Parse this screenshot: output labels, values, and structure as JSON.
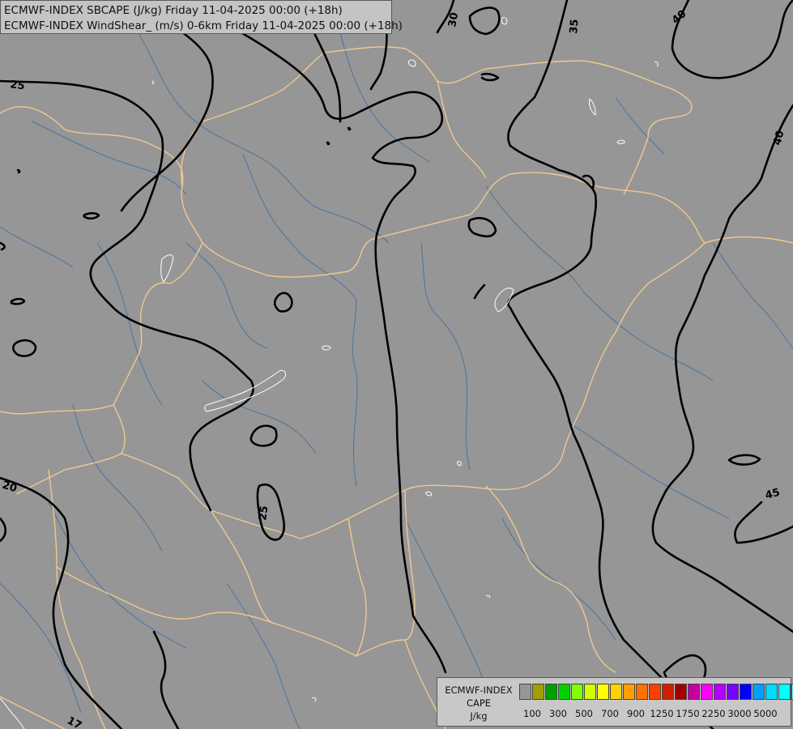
{
  "title": {
    "line1": "ECMWF-INDEX SBCAPE (J/kg) Friday 11-04-2025 00:00 (+18h)",
    "line2": "ECMWF-INDEX WindShear_ (m/s) 0-6km Friday 11-04-2025 00:00 (+18h)"
  },
  "legend": {
    "title": [
      "ECMWF-INDEX",
      "CAPE",
      "J/kg"
    ],
    "colors": [
      "#969696",
      "#a0a000",
      "#00a000",
      "#00d200",
      "#80ff00",
      "#d2ff00",
      "#ffff00",
      "#ffd200",
      "#ffa000",
      "#ff7000",
      "#ff4000",
      "#d21e00",
      "#a00000",
      "#c800a0",
      "#ff00ff",
      "#b400ff",
      "#7800ff",
      "#0000ff",
      "#00a0ff",
      "#00dcff",
      "#00ffff",
      "#80ffff",
      "#ffffff"
    ],
    "tick_labels": [
      "100",
      "300",
      "500",
      "700",
      "900",
      "1250",
      "1750",
      "2250",
      "3000",
      "5000"
    ]
  },
  "contour_labels": [
    {
      "text": "25"
    },
    {
      "text": "30"
    },
    {
      "text": "35"
    },
    {
      "text": "40"
    },
    {
      "text": "40"
    },
    {
      "text": "20"
    },
    {
      "text": "25"
    },
    {
      "text": "45"
    },
    {
      "text": "17"
    }
  ]
}
